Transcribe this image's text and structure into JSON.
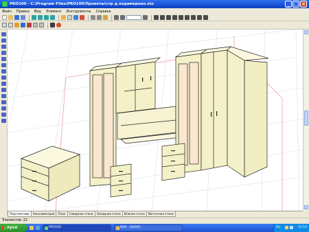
{
  "window": {
    "title": "PRO100 - C:\\Program Files\\PRO100\\Проекты\\стр д.ходимероен.sto"
  },
  "menu": {
    "items": [
      "Файл",
      "Правка",
      "Вид",
      "Элемент",
      "Инструменты",
      "Справка"
    ]
  },
  "toolbar": {
    "zoom_value": ""
  },
  "view_tabs": [
    "Перспектива",
    "Аксонометрия",
    "План",
    "Северная стена",
    "Западная стена",
    "Южная стена",
    "Восточная стена"
  ],
  "status": {
    "text": "Элементов: 22"
  },
  "taskbar": {
    "start_label": "пуск",
    "tasks": [
      "PRO100",
      "BOX - [BOX0]"
    ],
    "lang": "RU",
    "clock": "15:10"
  },
  "colors": {
    "titlebar": "#0a3fbf",
    "furniture_fill": "#f4f1c8",
    "furniture_stroke": "#222222",
    "grid": "#d9d9f2"
  }
}
